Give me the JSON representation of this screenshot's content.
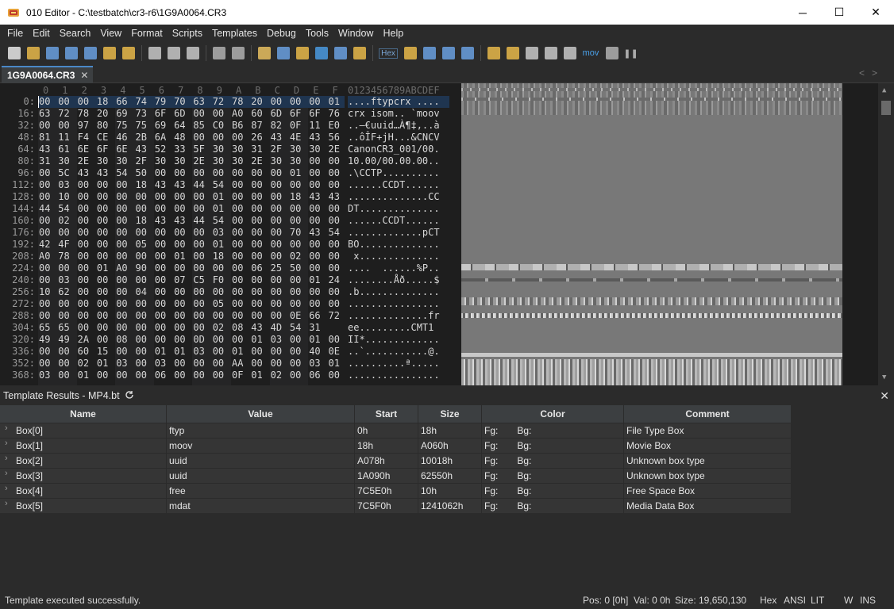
{
  "window": {
    "title": "010 Editor - C:\\testbatch\\cr3-r6\\1G9A0064.CR3",
    "minimize": "─",
    "maximize": "☐",
    "close": "✕"
  },
  "menu": [
    "File",
    "Edit",
    "Search",
    "View",
    "Format",
    "Scripts",
    "Templates",
    "Debug",
    "Tools",
    "Window",
    "Help"
  ],
  "toolbar": {
    "hex_label": "Hex",
    "mov_label": "mov",
    "icons": [
      "new-file-icon",
      "open-file-icon",
      "save-icon",
      "save-as-icon",
      "save-all-icon",
      "open-folder-icon",
      "workspace-icon",
      "cut-icon",
      "copy-icon",
      "paste-icon",
      "undo-icon",
      "redo-icon",
      "find-icon",
      "replace-icon",
      "find-in-files-icon",
      "goto-icon",
      "template-icon",
      "script-icon",
      "hex-mode-icon",
      "text-format-icon",
      "whitespace-icon",
      "columns-icon",
      "highlight-icon",
      "calculator-icon",
      "bookmark-icon",
      "compare-icon",
      "histogram-icon",
      "checksum-icon",
      "mov-icon",
      "base-convert-icon",
      "pause-icon"
    ]
  },
  "file_tab": {
    "name": "1G9A0064.CR3",
    "close": "✕"
  },
  "tab_nav": {
    "left": "<",
    "right": ">"
  },
  "hex": {
    "column_headers": [
      "0",
      "1",
      "2",
      "3",
      "4",
      "5",
      "6",
      "7",
      "8",
      "9",
      "A",
      "B",
      "C",
      "D",
      "E",
      "F"
    ],
    "ascii_header": "0123456789ABCDEF",
    "rows": [
      {
        "addr": "0:",
        "bytes": [
          "00",
          "00",
          "00",
          "18",
          "66",
          "74",
          "79",
          "70",
          "63",
          "72",
          "78",
          "20",
          "00",
          "00",
          "00",
          "01"
        ],
        "ascii": "....ftypcrx ...."
      },
      {
        "addr": "16:",
        "bytes": [
          "63",
          "72",
          "78",
          "20",
          "69",
          "73",
          "6F",
          "6D",
          "00",
          "00",
          "A0",
          "60",
          "6D",
          "6F",
          "6F",
          "76"
        ],
        "ascii": "crx isom.. `moov"
      },
      {
        "addr": "32:",
        "bytes": [
          "00",
          "00",
          "97",
          "80",
          "75",
          "75",
          "69",
          "64",
          "85",
          "C0",
          "B6",
          "87",
          "82",
          "0F",
          "11",
          "E0"
        ],
        "ascii": "..—€uuid…À¶‡‚..à"
      },
      {
        "addr": "48:",
        "bytes": [
          "81",
          "11",
          "F4",
          "CE",
          "46",
          "2B",
          "6A",
          "48",
          "00",
          "00",
          "00",
          "26",
          "43",
          "4E",
          "43",
          "56"
        ],
        "ascii": "..ôÎF+jH...&CNCV"
      },
      {
        "addr": "64:",
        "bytes": [
          "43",
          "61",
          "6E",
          "6F",
          "6E",
          "43",
          "52",
          "33",
          "5F",
          "30",
          "30",
          "31",
          "2F",
          "30",
          "30",
          "2E"
        ],
        "ascii": "CanonCR3_001/00."
      },
      {
        "addr": "80:",
        "bytes": [
          "31",
          "30",
          "2E",
          "30",
          "30",
          "2F",
          "30",
          "30",
          "2E",
          "30",
          "30",
          "2E",
          "30",
          "30",
          "00",
          "00"
        ],
        "ascii": "10.00/00.00.00.."
      },
      {
        "addr": "96:",
        "bytes": [
          "00",
          "5C",
          "43",
          "43",
          "54",
          "50",
          "00",
          "00",
          "00",
          "00",
          "00",
          "00",
          "00",
          "01",
          "00",
          "00"
        ],
        "ascii": ".\\CCTP.........."
      },
      {
        "addr": "112:",
        "bytes": [
          "00",
          "03",
          "00",
          "00",
          "00",
          "18",
          "43",
          "43",
          "44",
          "54",
          "00",
          "00",
          "00",
          "00",
          "00",
          "00"
        ],
        "ascii": "......CCDT......"
      },
      {
        "addr": "128:",
        "bytes": [
          "00",
          "10",
          "00",
          "00",
          "00",
          "00",
          "00",
          "00",
          "00",
          "01",
          "00",
          "00",
          "00",
          "18",
          "43",
          "43"
        ],
        "ascii": "..............CC"
      },
      {
        "addr": "144:",
        "bytes": [
          "44",
          "54",
          "00",
          "00",
          "00",
          "00",
          "00",
          "00",
          "00",
          "01",
          "00",
          "00",
          "00",
          "00",
          "00",
          "00"
        ],
        "ascii": "DT.............."
      },
      {
        "addr": "160:",
        "bytes": [
          "00",
          "02",
          "00",
          "00",
          "00",
          "18",
          "43",
          "43",
          "44",
          "54",
          "00",
          "00",
          "00",
          "00",
          "00",
          "00"
        ],
        "ascii": "......CCDT......"
      },
      {
        "addr": "176:",
        "bytes": [
          "00",
          "00",
          "00",
          "00",
          "00",
          "00",
          "00",
          "00",
          "00",
          "03",
          "00",
          "00",
          "00",
          "70",
          "43",
          "54"
        ],
        "ascii": ".............pCT"
      },
      {
        "addr": "192:",
        "bytes": [
          "42",
          "4F",
          "00",
          "00",
          "00",
          "05",
          "00",
          "00",
          "00",
          "01",
          "00",
          "00",
          "00",
          "00",
          "00",
          "00"
        ],
        "ascii": "BO.............."
      },
      {
        "addr": "208:",
        "bytes": [
          "A0",
          "78",
          "00",
          "00",
          "00",
          "00",
          "00",
          "01",
          "00",
          "18",
          "00",
          "00",
          "00",
          "02",
          "00",
          "00"
        ],
        "ascii": " x.............."
      },
      {
        "addr": "224:",
        "bytes": [
          "00",
          "00",
          "00",
          "01",
          "A0",
          "90",
          "00",
          "00",
          "00",
          "00",
          "00",
          "06",
          "25",
          "50",
          "00",
          "00"
        ],
        "ascii": "....  ......%P.."
      },
      {
        "addr": "240:",
        "bytes": [
          "00",
          "03",
          "00",
          "00",
          "00",
          "00",
          "00",
          "07",
          "C5",
          "F0",
          "00",
          "00",
          "00",
          "00",
          "01",
          "24"
        ],
        "ascii": "........Åð.....$"
      },
      {
        "addr": "256:",
        "bytes": [
          "10",
          "62",
          "00",
          "00",
          "00",
          "04",
          "00",
          "00",
          "00",
          "00",
          "00",
          "00",
          "00",
          "00",
          "00",
          "00"
        ],
        "ascii": ".b.............."
      },
      {
        "addr": "272:",
        "bytes": [
          "00",
          "00",
          "00",
          "00",
          "00",
          "00",
          "00",
          "00",
          "00",
          "05",
          "00",
          "00",
          "00",
          "00",
          "00",
          "00"
        ],
        "ascii": "................"
      },
      {
        "addr": "288:",
        "bytes": [
          "00",
          "00",
          "00",
          "00",
          "00",
          "00",
          "00",
          "00",
          "00",
          "00",
          "00",
          "00",
          "00",
          "0E",
          "66",
          "72"
        ],
        "ascii": "..............fr"
      },
      {
        "addr": "304:",
        "bytes": [
          "65",
          "65",
          "00",
          "00",
          "00",
          "00",
          "00",
          "00",
          "00",
          "02",
          "08",
          "43",
          "4D",
          "54",
          "31"
        ],
        "ascii": "ee.........CMT1"
      },
      {
        "addr": "320:",
        "bytes": [
          "49",
          "49",
          "2A",
          "00",
          "08",
          "00",
          "00",
          "00",
          "0D",
          "00",
          "00",
          "01",
          "03",
          "00",
          "01",
          "00"
        ],
        "ascii": "II*............."
      },
      {
        "addr": "336:",
        "bytes": [
          "00",
          "00",
          "60",
          "15",
          "00",
          "00",
          "01",
          "01",
          "03",
          "00",
          "01",
          "00",
          "00",
          "00",
          "40",
          "0E"
        ],
        "ascii": "..`...........@."
      },
      {
        "addr": "352:",
        "bytes": [
          "00",
          "00",
          "02",
          "01",
          "03",
          "00",
          "03",
          "00",
          "00",
          "00",
          "AA",
          "00",
          "00",
          "00",
          "03",
          "01"
        ],
        "ascii": "..........ª....."
      },
      {
        "addr": "368:",
        "bytes": [
          "03",
          "00",
          "01",
          "00",
          "00",
          "00",
          "06",
          "00",
          "00",
          "00",
          "0F",
          "01",
          "02",
          "00",
          "06",
          "00"
        ],
        "ascii": "................"
      }
    ]
  },
  "template_panel": {
    "title": "Template Results - MP4.bt",
    "refresh_icon": "refresh-icon",
    "close": "✕",
    "columns": [
      "Name",
      "Value",
      "Start",
      "Size",
      "Color",
      "Comment"
    ],
    "rows": [
      {
        "name": "Box[0]",
        "value": "ftyp",
        "start": "0h",
        "size": "18h",
        "fg": "Fg:",
        "bg": "Bg:",
        "comment": "File Type Box"
      },
      {
        "name": "Box[1]",
        "value": "moov",
        "start": "18h",
        "size": "A060h",
        "fg": "Fg:",
        "bg": "Bg:",
        "comment": "Movie Box"
      },
      {
        "name": "Box[2]",
        "value": "uuid",
        "start": "A078h",
        "size": "10018h",
        "fg": "Fg:",
        "bg": "Bg:",
        "comment": "Unknown box type"
      },
      {
        "name": "Box[3]",
        "value": "uuid",
        "start": "1A090h",
        "size": "62550h",
        "fg": "Fg:",
        "bg": "Bg:",
        "comment": "Unknown box type"
      },
      {
        "name": "Box[4]",
        "value": "free",
        "start": "7C5E0h",
        "size": "10h",
        "fg": "Fg:",
        "bg": "Bg:",
        "comment": "Free Space Box"
      },
      {
        "name": "Box[5]",
        "value": "mdat",
        "start": "7C5F0h",
        "size": "1241062h",
        "fg": "Fg:",
        "bg": "Bg:",
        "comment": "Media Data Box"
      }
    ]
  },
  "status": {
    "message": "Template executed successfully.",
    "pos": "Pos: 0 [0h]",
    "val": "Val: 0 0h",
    "size": "Size: 19,650,130",
    "mode": "Hex",
    "encoding": "ANSI",
    "endian": "LIT",
    "w": "W",
    "ins": "INS"
  },
  "colors": {
    "background": "#2b2b2b",
    "editor_bg": "#1e1e1e",
    "selection": "#1f3550",
    "accent": "#4a88c7"
  }
}
